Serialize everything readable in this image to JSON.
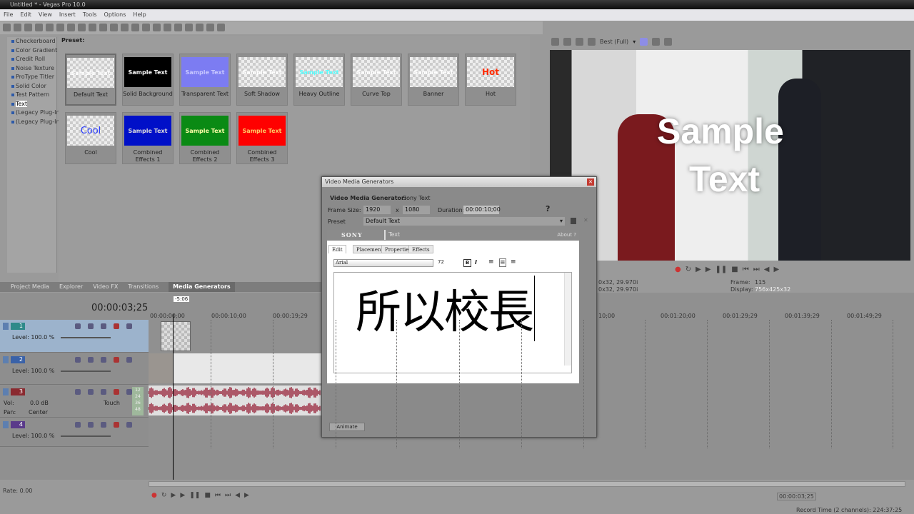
{
  "window": {
    "title": "Untitled * - Vegas Pro 10.0"
  },
  "menu": [
    "File",
    "Edit",
    "View",
    "Insert",
    "Tools",
    "Options",
    "Help"
  ],
  "tree": [
    "Checkerboard",
    "Color Gradient",
    "Credit Roll",
    "Noise Texture",
    "ProType Titler",
    "Solid Color",
    "Test Pattern",
    "Text",
    "(Legacy Plug-In)",
    "(Legacy Plug-In)"
  ],
  "tree_selected": "Text",
  "presets": {
    "label": "Preset:",
    "items": [
      {
        "name": "Default Text",
        "thumb": "Sample Text",
        "bg": "checker",
        "color": "#ffffff"
      },
      {
        "name": "Solid Background",
        "thumb": "Sample Text",
        "bg": "#000000",
        "color": "#ffffff"
      },
      {
        "name": "Transparent Text",
        "thumb": "Sample Text",
        "bg": "#7c7cf2",
        "color": "#c8c8ff"
      },
      {
        "name": "Soft Shadow",
        "thumb": "Sample Text",
        "bg": "checker",
        "color": "#ffffff"
      },
      {
        "name": "Heavy Outline",
        "thumb": "Sample Text",
        "bg": "checker",
        "color": "#55ffff"
      },
      {
        "name": "Curve Top",
        "thumb": "Sample Text",
        "bg": "checker",
        "color": "#ffffff"
      },
      {
        "name": "Banner",
        "thumb": "Sample Text",
        "bg": "checker",
        "color": "#ffffff"
      },
      {
        "name": "Hot",
        "thumb": "Hot",
        "bg": "checker",
        "color": "#ff2a00"
      },
      {
        "name": "Cool",
        "thumb": "Cool",
        "bg": "checker",
        "color": "#2a3cff"
      },
      {
        "name": "Combined Effects 1",
        "thumb": "Sample Text",
        "bg": "#0010c8",
        "color": "#dddddd"
      },
      {
        "name": "Combined Effects 2",
        "thumb": "Sample Text",
        "bg": "#0a8a14",
        "color": "#ffffaa"
      },
      {
        "name": "Combined Effects 3",
        "thumb": "Sample Text",
        "bg": "#ff0000",
        "color": "#ffcc66"
      }
    ]
  },
  "tabs": [
    "Project Media",
    "Explorer",
    "Video FX",
    "Transitions",
    "Media Generators"
  ],
  "active_tab": "Media Generators",
  "preview": {
    "quality": "Best (Full)",
    "overlay_text_1": "Sample",
    "overlay_text_2": "Text",
    "info_line_1": "0x32, 29.970i",
    "info_line_2": "0x32, 29.970i",
    "frame_label": "Frame:",
    "frame": "115",
    "display_label": "Display:",
    "display": "756x425x32"
  },
  "timeline": {
    "timecode": "00:00:03;25",
    "marker": "-5:06",
    "ruler": [
      "00:00:00;00",
      "00:00:10;00",
      "00:00:19;29"
    ],
    "ruler_right": [
      "10;00",
      "00:01:20;00",
      "00:01:29;29",
      "00:01:39;29",
      "00:01:49;29"
    ],
    "tracks": [
      {
        "num": "1",
        "level": "Level: 100.0 %",
        "color": "#2f8a8a"
      },
      {
        "num": "2",
        "level": "Level: 100.0 %",
        "color": "#3a62a8"
      },
      {
        "num": "3",
        "vol_label": "Vol:",
        "vol": "0.0 dB",
        "pan_label": "Pan:",
        "pan": "Center",
        "mode": "Touch",
        "color": "#8a2a30",
        "meter": [
          "12",
          "24",
          "36",
          "48"
        ]
      },
      {
        "num": "4",
        "level": "Level: 100.0 %",
        "color": "#5a3a8a"
      }
    ]
  },
  "rate": "Rate: 0.00",
  "status": {
    "timecode": "00:00:03;25",
    "record_time": "Record Time (2 channels): 224:37:25"
  },
  "dialog": {
    "title": "Video Media Generators",
    "generator_label": "Video Media Generator:",
    "generator": "Sony Text",
    "frame_label": "Frame Size:",
    "width": "1920",
    "x": "x",
    "height": "1080",
    "duration_label": "Duration:",
    "duration": "00:00:10;00",
    "preset_label": "Preset",
    "preset": "Default Text",
    "brand": "SONY",
    "plugin": "Text",
    "about": "About ?",
    "tabs": [
      "Edit",
      "Placement",
      "Properties",
      "Effects"
    ],
    "font": "Arial",
    "size": "72",
    "bold": "B",
    "italic": "I",
    "text": "所以校長",
    "animate": "Animate"
  }
}
